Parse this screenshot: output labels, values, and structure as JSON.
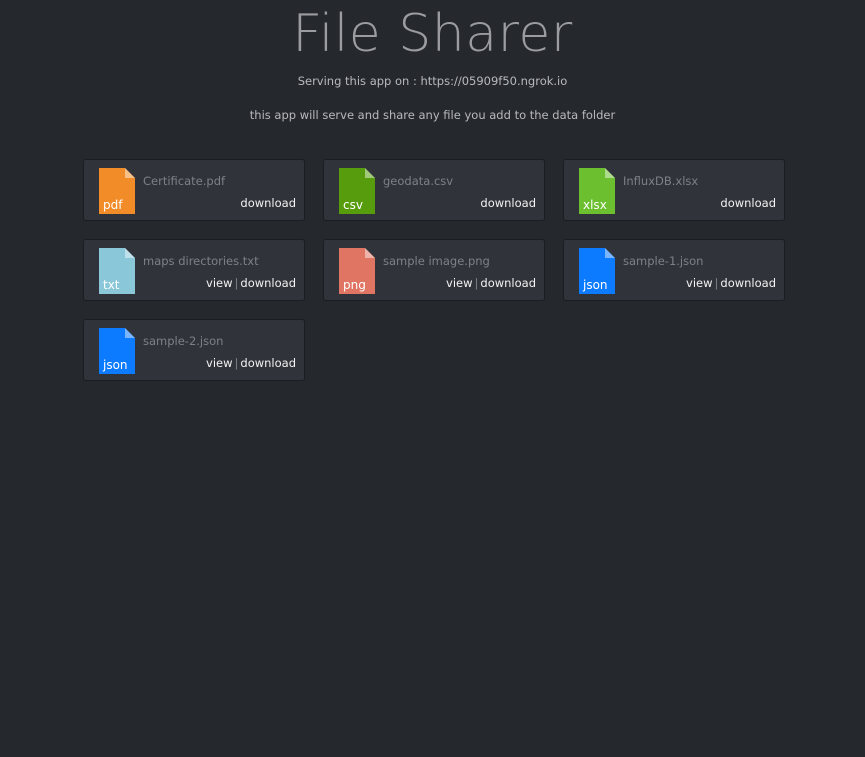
{
  "header": {
    "title": "File Sharer",
    "serving_text": "Serving this app on : https://05909f50.ngrok.io",
    "description": "this app will serve and share any file you add to the data folder"
  },
  "actions": {
    "view_label": "view",
    "download_label": "download",
    "separator": "|"
  },
  "files": [
    {
      "name": "Certificate.pdf",
      "ext": "pdf",
      "color": "#f28c28",
      "has_view": false
    },
    {
      "name": "geodata.csv",
      "ext": "csv",
      "color": "#579c0d",
      "has_view": false
    },
    {
      "name": "InfluxDB.xlsx",
      "ext": "xlsx",
      "color": "#6cbf2e",
      "has_view": false
    },
    {
      "name": "maps directories.txt",
      "ext": "txt",
      "color": "#8ac7d9",
      "has_view": true
    },
    {
      "name": "sample image.png",
      "ext": "png",
      "color": "#e07563",
      "has_view": true
    },
    {
      "name": "sample-1.json",
      "ext": "json",
      "color": "#0d7bff",
      "has_view": true
    },
    {
      "name": "sample-2.json",
      "ext": "json",
      "color": "#0d7bff",
      "has_view": true
    }
  ]
}
